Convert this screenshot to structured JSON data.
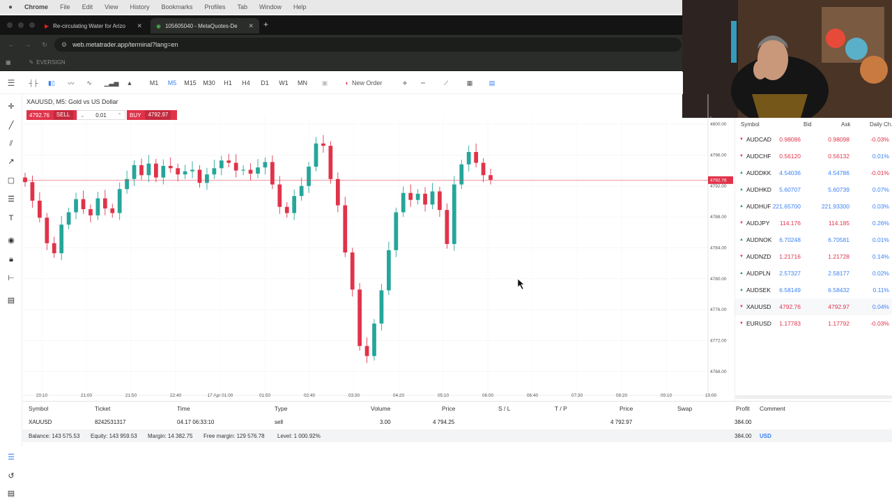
{
  "menubar": {
    "app": "Chrome",
    "items": [
      "File",
      "Edit",
      "View",
      "History",
      "Bookmarks",
      "Profiles",
      "Tab",
      "Window",
      "Help"
    ]
  },
  "tabs": [
    {
      "label": "Re-circulating Water for Arizo",
      "active": false
    },
    {
      "label": "105605040 - MetaQuotes-De",
      "active": true
    }
  ],
  "url": "web.metatrader.app/terminal?lang=en",
  "bookmark_label": "EVERSIGN",
  "toolbar": {
    "timeframes": [
      "M1",
      "M5",
      "M15",
      "M30",
      "H1",
      "H4",
      "D1",
      "W1",
      "MN"
    ],
    "active_timeframe": "M5",
    "new_order_label": "New Order"
  },
  "chart": {
    "title": "XAUUSD, M5: Gold vs US Dollar",
    "sell_price": "4792.76",
    "sell_label": "SELL",
    "volume": "0.01",
    "buy_label": "BUY",
    "buy_price": "4792.97",
    "current_price_tag": "4792.76",
    "price_axis": [
      "4800.00",
      "4796.00",
      "4792.00",
      "4788.00",
      "4784.00",
      "4780.00",
      "4776.00",
      "4772.00",
      "4768.00"
    ],
    "time_axis": [
      "20:10",
      "21:00",
      "21:50",
      "22:40",
      "17 Apr 01:00",
      "01:50",
      "02:40",
      "03:30",
      "04:20",
      "05:10",
      "06:00",
      "06:40",
      "07:30",
      "08:20",
      "09:10",
      "10:00"
    ]
  },
  "chart_data": {
    "type": "candlestick",
    "symbol": "XAUUSD",
    "timeframe": "M5",
    "ylim": [
      4766,
      4801
    ],
    "current_price": 4792.76,
    "x_ticks": [
      "20:10",
      "21:00",
      "21:50",
      "22:40",
      "17 Apr 01:00",
      "01:50",
      "02:40",
      "03:30",
      "04:20",
      "05:10",
      "06:00",
      "06:40",
      "07:30",
      "08:20",
      "09:10",
      "10:00"
    ],
    "closes": [
      4792.5,
      4790.1,
      4787.9,
      4784.6,
      4783.3,
      4787.0,
      4788.6,
      4790.3,
      4789.0,
      4788.2,
      4790.4,
      4789.1,
      4788.5,
      4791.6,
      4792.9,
      4794.7,
      4793.4,
      4794.9,
      4793.1,
      4794.6,
      4794.3,
      4793.5,
      4793.9,
      4794.1,
      4792.4,
      4793.5,
      4794.3,
      4795.3,
      4795.0,
      4794.0,
      4794.1,
      4793.6,
      4794.4,
      4795.1,
      4792.2,
      4789.3,
      4788.5,
      4790.7,
      4792.0,
      4794.5,
      4797.5,
      4797.2,
      4792.9,
      4789.5,
      4783.4,
      4778.6,
      4771.3,
      4770.0,
      4774.2,
      4778.5,
      4783.7,
      4788.6,
      4791.1,
      4790.2,
      4791.0,
      4789.6,
      4791.3,
      4788.9,
      4784.5,
      4792.2,
      4794.8,
      4796.4,
      4795.0,
      4793.4,
      4792.8
    ]
  },
  "market_watch": {
    "headers": [
      "Symbol",
      "Bid",
      "Ask",
      "Daily Ch..."
    ],
    "rows": [
      {
        "dir": "down",
        "symbol": "AUDCAD",
        "bid": "0.98086",
        "ask": "0.98098",
        "change": "-0.03%",
        "bidcolor": "red"
      },
      {
        "dir": "down",
        "symbol": "AUDCHF",
        "bid": "0.56120",
        "ask": "0.56132",
        "change": "0.01%",
        "bidcolor": "red"
      },
      {
        "dir": "up",
        "symbol": "AUDDKK",
        "bid": "4.54036",
        "ask": "4.54786",
        "change": "-0.01%",
        "bidcolor": "blue"
      },
      {
        "dir": "up",
        "symbol": "AUDHKD",
        "bid": "5.60707",
        "ask": "5.60739",
        "change": "0.07%",
        "bidcolor": "blue"
      },
      {
        "dir": "up",
        "symbol": "AUDHUF",
        "bid": "221.65700",
        "ask": "221.93300",
        "change": "0.03%",
        "bidcolor": "blue"
      },
      {
        "dir": "down",
        "symbol": "AUDJPY",
        "bid": "114.176",
        "ask": "114.185",
        "change": "0.26%",
        "bidcolor": "red"
      },
      {
        "dir": "up",
        "symbol": "AUDNOK",
        "bid": "6.70248",
        "ask": "6.70581",
        "change": "0.01%",
        "bidcolor": "blue"
      },
      {
        "dir": "down",
        "symbol": "AUDNZD",
        "bid": "1.21716",
        "ask": "1.21728",
        "change": "0.14%",
        "bidcolor": "red"
      },
      {
        "dir": "up",
        "symbol": "AUDPLN",
        "bid": "2.57327",
        "ask": "2.58177",
        "change": "0.02%",
        "bidcolor": "blue"
      },
      {
        "dir": "up",
        "symbol": "AUDSEK",
        "bid": "6.58149",
        "ask": "6.58432",
        "change": "0.11%",
        "bidcolor": "blue"
      },
      {
        "dir": "down",
        "symbol": "XAUUSD",
        "bid": "4792.76",
        "ask": "4792.97",
        "change": "0.04%",
        "bidcolor": "red"
      },
      {
        "dir": "down",
        "symbol": "EURUSD",
        "bid": "1.17783",
        "ask": "1.17792",
        "change": "-0.03%",
        "bidcolor": "red"
      }
    ]
  },
  "positions": {
    "headers": [
      "Symbol",
      "Ticket",
      "Time",
      "Type",
      "Volume",
      "Price",
      "S / L",
      "T / P",
      "Price",
      "Swap",
      "Profit",
      "Comment"
    ],
    "row": {
      "symbol": "XAUUSD",
      "ticket": "8242531317",
      "time": "04.17 06:33:10",
      "type": "sell",
      "volume": "3.00",
      "price": "4 794.25",
      "cur_price": "4 792.97",
      "profit": "384.00"
    },
    "summary": {
      "balance": "Balance: 143 575.53",
      "equity": "Equity: 143 959.53",
      "margin": "Margin: 14 382.75",
      "free_margin": "Free margin: 129 576.78",
      "level": "Level: 1 000.92%",
      "total": "384.00",
      "currency": "USD"
    }
  },
  "colors": {
    "bull": "#26a69a",
    "bear": "#e0334a",
    "accent": "#3b82f6"
  }
}
